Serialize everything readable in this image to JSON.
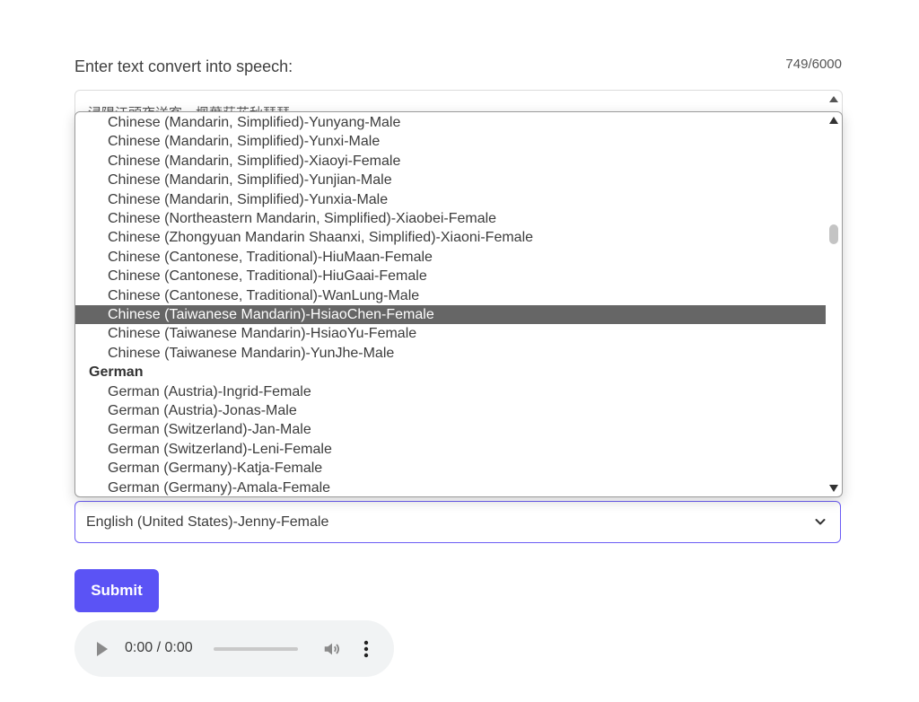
{
  "form": {
    "label": "Enter text convert into speech:",
    "counter": "749/6000",
    "textarea_text": "浸陽江頭夜送客，楓葉荻花秋瑟瑟。"
  },
  "dropdown": {
    "rows": [
      {
        "type": "option",
        "label": "Chinese (Mandarin, Simplified)-Yunyang-Male"
      },
      {
        "type": "option",
        "label": "Chinese (Mandarin, Simplified)-Yunxi-Male"
      },
      {
        "type": "option",
        "label": "Chinese (Mandarin, Simplified)-Xiaoyi-Female"
      },
      {
        "type": "option",
        "label": "Chinese (Mandarin, Simplified)-Yunjian-Male"
      },
      {
        "type": "option",
        "label": "Chinese (Mandarin, Simplified)-Yunxia-Male"
      },
      {
        "type": "option",
        "label": "Chinese (Northeastern Mandarin, Simplified)-Xiaobei-Female"
      },
      {
        "type": "option",
        "label": "Chinese (Zhongyuan Mandarin Shaanxi, Simplified)-Xiaoni-Female"
      },
      {
        "type": "option",
        "label": "Chinese (Cantonese, Traditional)-HiuMaan-Female"
      },
      {
        "type": "option",
        "label": "Chinese (Cantonese, Traditional)-HiuGaai-Female"
      },
      {
        "type": "option",
        "label": "Chinese (Cantonese, Traditional)-WanLung-Male"
      },
      {
        "type": "option",
        "label": "Chinese (Taiwanese Mandarin)-HsiaoChen-Female",
        "selected": true
      },
      {
        "type": "option",
        "label": "Chinese (Taiwanese Mandarin)-HsiaoYu-Female"
      },
      {
        "type": "option",
        "label": "Chinese (Taiwanese Mandarin)-YunJhe-Male"
      },
      {
        "type": "group",
        "label": "German"
      },
      {
        "type": "option",
        "label": "German (Austria)-Ingrid-Female"
      },
      {
        "type": "option",
        "label": "German (Austria)-Jonas-Male"
      },
      {
        "type": "option",
        "label": "German (Switzerland)-Jan-Male"
      },
      {
        "type": "option",
        "label": "German (Switzerland)-Leni-Female"
      },
      {
        "type": "option",
        "label": "German (Germany)-Katja-Female"
      },
      {
        "type": "option",
        "label": "German (Germany)-Amala-Female"
      }
    ]
  },
  "voice_select": {
    "value": "English (United States)-Jenny-Female"
  },
  "submit_label": "Submit",
  "audio": {
    "time": "0:00 / 0:00",
    "progress": 0
  },
  "colors": {
    "accent": "#5b53f5",
    "select_border": "#6b5cf5",
    "selected_row": "#666666",
    "audio_bg": "#f1f3f4"
  },
  "icons": {
    "play": "play-icon",
    "volume": "volume-icon",
    "more": "more-vert-icon",
    "chevron": "chevron-down-icon"
  }
}
